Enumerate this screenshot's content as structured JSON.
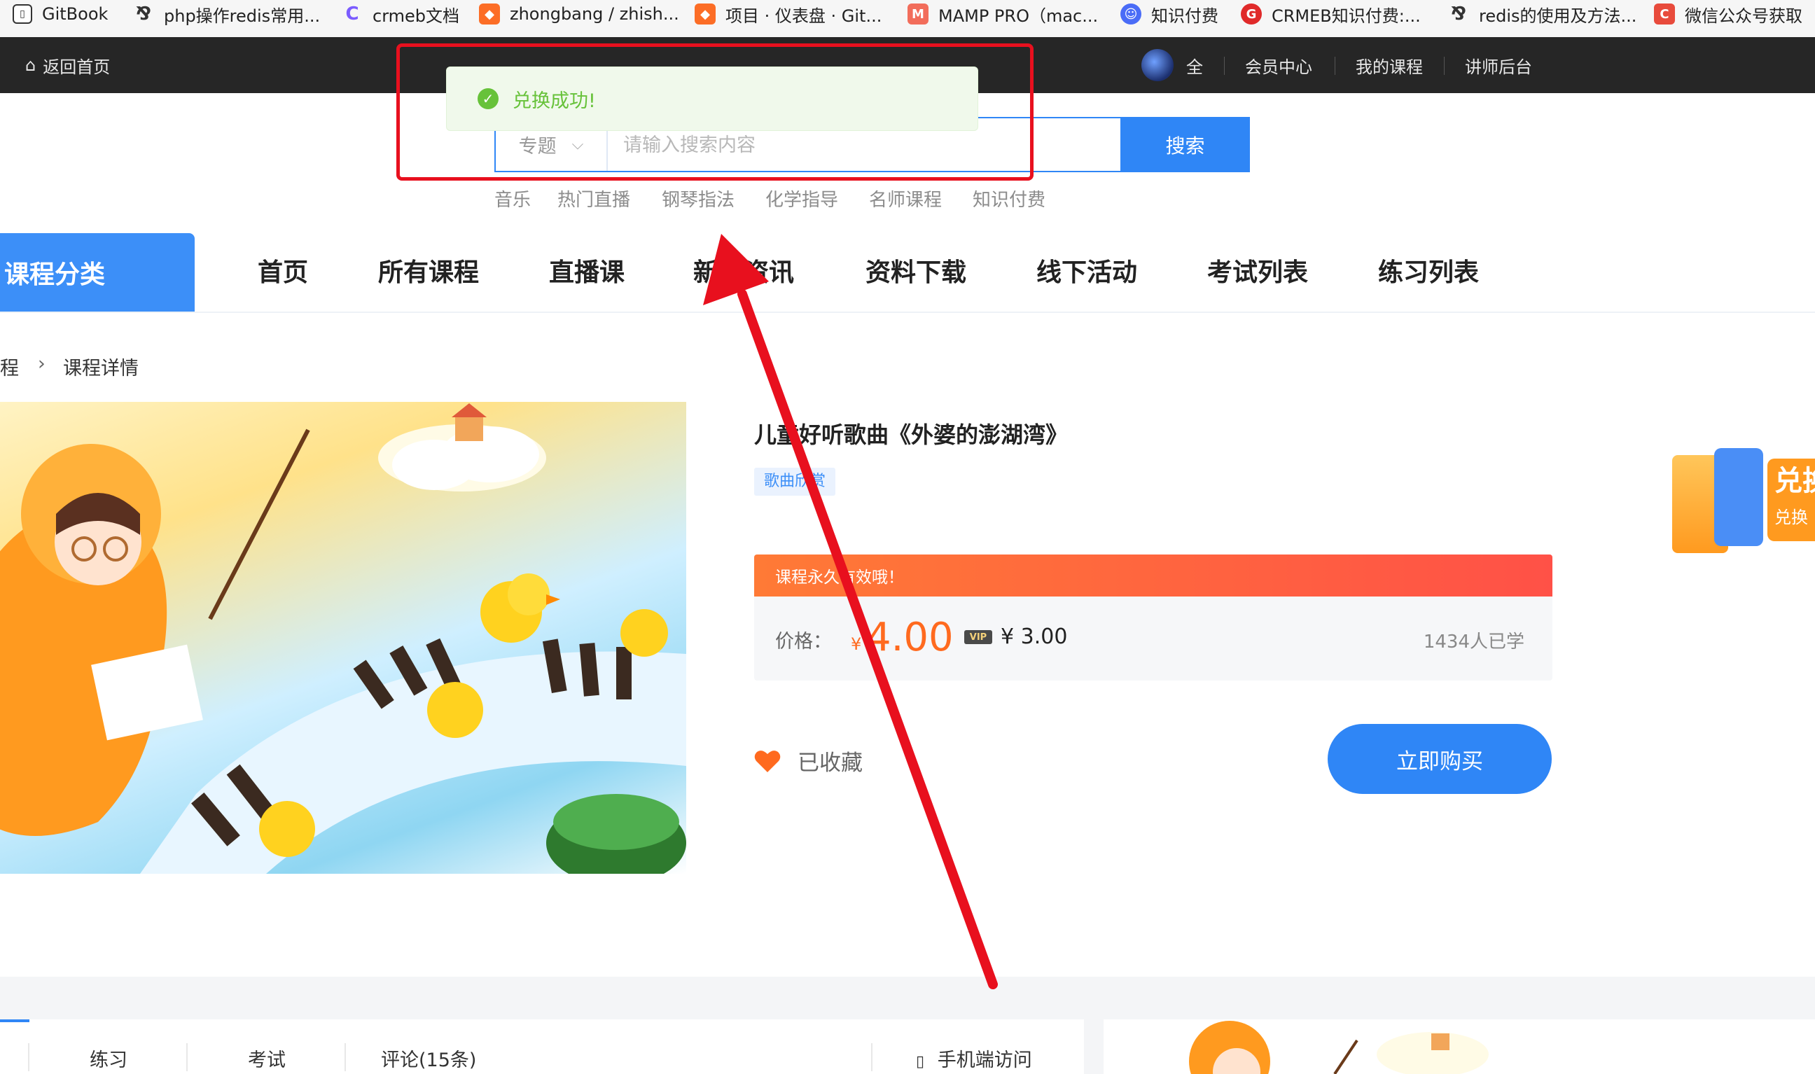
{
  "bookmarks": [
    {
      "label": "GitBook",
      "icon": "gitbook-icon",
      "color": "#555555"
    },
    {
      "label": "php操作redis常用...",
      "icon": "yuque-icon",
      "color": "#333333"
    },
    {
      "label": "crmeb文档",
      "icon": "crmeb-c-icon",
      "color": "#7b5cff"
    },
    {
      "label": "zhongbang / zhish...",
      "icon": "gitlab-icon",
      "color": "#fc6d26"
    },
    {
      "label": "项目 · 仪表盘 · Git...",
      "icon": "gitlab-icon",
      "color": "#fc6d26"
    },
    {
      "label": "MAMP PRO（mac...",
      "icon": "mamp-icon",
      "color": "#f26d5b"
    },
    {
      "label": "知识付费",
      "icon": "ghost-icon",
      "color": "#4a6cf7"
    },
    {
      "label": "CRMEB知识付费:...",
      "icon": "crmeb-icon",
      "color": "#e02a2a"
    },
    {
      "label": "redis的使用及方法...",
      "icon": "yuque-icon",
      "color": "#333333"
    },
    {
      "label": "微信公众号获取",
      "icon": "csdn-c-icon",
      "color": "#e84b3c"
    }
  ],
  "topbar": {
    "home": "返回首页",
    "user_name": "全",
    "member_center": "会员中心",
    "my_courses": "我的课程",
    "teacher_backend": "讲师后台"
  },
  "search": {
    "scope": "专题",
    "placeholder": "请输入搜索内容",
    "button": "搜索",
    "hot_words": [
      "音乐",
      "热门直播",
      "钢琴指法",
      "化学指导",
      "名师课程",
      "知识付费"
    ]
  },
  "nav": {
    "category": "课程分类",
    "items": [
      "首页",
      "所有课程",
      "直播课",
      "新闻资讯",
      "资料下载",
      "线下活动",
      "考试列表",
      "练习列表"
    ]
  },
  "breadcrumb": {
    "parent": "课程",
    "current": "课程详情"
  },
  "course": {
    "title": "儿童好听歌曲《外婆的澎湖湾》",
    "tag": "歌曲欣赏",
    "promo": "课程永久有效哦！",
    "price_label": "价格：",
    "currency": "¥",
    "price": "4.00",
    "vip_badge": "VIP",
    "vip_price": "¥ 3.00",
    "learners": "1434人已学",
    "favorite": "已收藏",
    "buy_button": "立即购买"
  },
  "floating": {
    "line1": "兑换",
    "line2": "兑换"
  },
  "tabs": {
    "items": [
      "练习",
      "考试",
      "评论(15条)"
    ],
    "mobile": "手机端访问"
  },
  "toast": {
    "message": "兑换成功!"
  },
  "colors": {
    "primary": "#2f86f6",
    "accent": "#ff6a1f",
    "success": "#67c23a",
    "annotation": "#e8101e"
  }
}
